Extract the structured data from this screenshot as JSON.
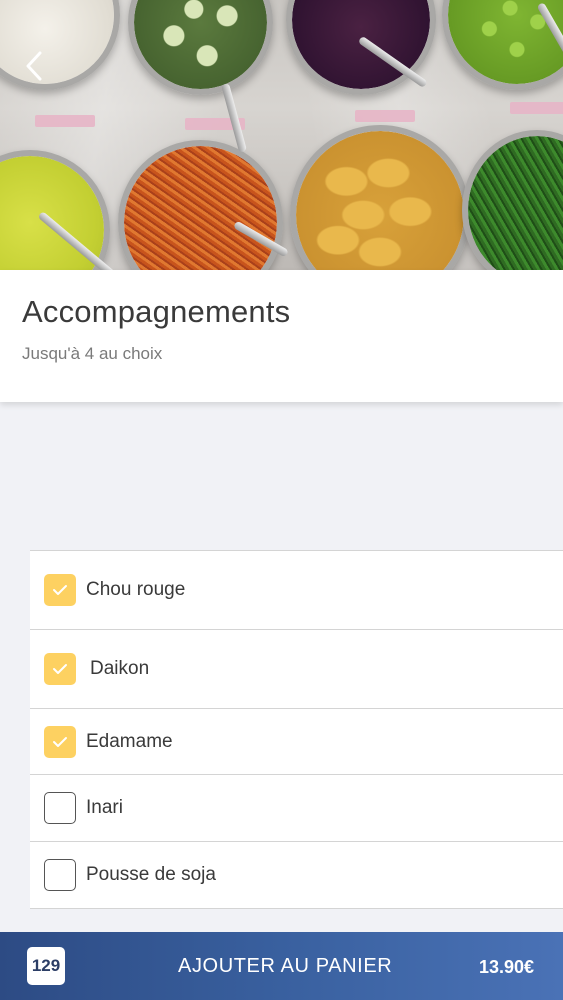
{
  "section": {
    "title": "Accompagnements",
    "subtitle": "Jusqu'à 4 au choix"
  },
  "options": [
    {
      "label": "Chou rouge",
      "checked": true
    },
    {
      "label": "Daikon",
      "checked": true
    },
    {
      "label": "Edamame",
      "checked": true
    },
    {
      "label": "Inari",
      "checked": false
    },
    {
      "label": "Pousse de soja",
      "checked": false
    }
  ],
  "cart": {
    "count": "129",
    "action_label": "AJOUTER AU PANIER",
    "price": "13.90€"
  },
  "icons": {
    "back": "chevron-left-icon",
    "check": "checkmark-icon"
  },
  "colors": {
    "checkbox_checked": "#fdd161",
    "cart_bar": "#39609f",
    "background": "#f1f2f6"
  }
}
